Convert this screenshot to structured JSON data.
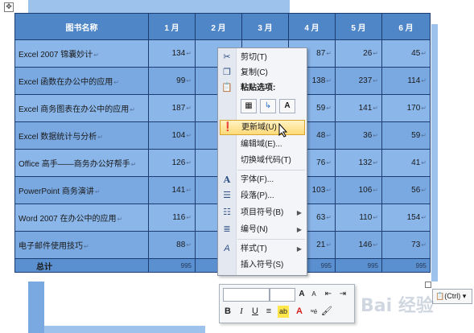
{
  "table": {
    "headers": [
      "图书名称",
      "1 月",
      "2 月",
      "3 月",
      "4 月",
      "5 月",
      "6 月"
    ],
    "rows": [
      {
        "name": "Excel 2007 锦囊妙计",
        "m1": "134",
        "m2": "",
        "m3": "",
        "m4": "87",
        "m5": "26",
        "m6": "45"
      },
      {
        "name": "Excel 函数在办公中的应用",
        "m1": "99",
        "m2": "",
        "m3": "",
        "m4": "138",
        "m5": "237",
        "m6": "114"
      },
      {
        "name": "Excel 商务图表在办公中的应用",
        "m1": "187",
        "m2": "",
        "m3": "",
        "m4": "59",
        "m5": "141",
        "m6": "170"
      },
      {
        "name": "Excel 数据统计与分析",
        "m1": "104",
        "m2": "",
        "m3": "",
        "m4": "48",
        "m5": "36",
        "m6": "59"
      },
      {
        "name": "Office 高手——商务办公好帮手",
        "m1": "126",
        "m2": "",
        "m3": "",
        "m4": "76",
        "m5": "132",
        "m6": "41"
      },
      {
        "name": "PowerPoint 商务演讲",
        "m1": "141",
        "m2": "",
        "m3": "",
        "m4": "103",
        "m5": "106",
        "m6": "56"
      },
      {
        "name": "Word 2007 在办公中的应用",
        "m1": "116",
        "m2": "",
        "m3": "",
        "m4": "63",
        "m5": "110",
        "m6": "154"
      },
      {
        "name": "电子邮件使用技巧",
        "m1": "88",
        "m2": "",
        "m3": "",
        "m4": "21",
        "m5": "146",
        "m6": "73"
      }
    ],
    "total": {
      "name": "总计",
      "m1": "995",
      "m2": "",
      "m3": "",
      "m4": "995",
      "m5": "995",
      "m6": "995"
    }
  },
  "pilcrow": "↵",
  "context_menu": {
    "cut": "剪切(T)",
    "copy": "复制(C)",
    "paste_options": "粘贴选项:",
    "update_field": "更新域(U)",
    "edit_field": "编辑域(E)...",
    "toggle_field_codes": "切换域代码(T)",
    "font": "字体(F)...",
    "paragraph": "段落(P)...",
    "bullets": "项目符号(B)",
    "numbering": "编号(N)",
    "styles": "样式(T)",
    "insert_symbol": "插入符号(S)"
  },
  "mini_toolbar": {
    "bold": "B",
    "italic": "I",
    "underline": "U",
    "grow_font": "A",
    "shrink_font": "A"
  },
  "paste_ctrl": "(Ctrl)",
  "watermark": "Bai 经验"
}
